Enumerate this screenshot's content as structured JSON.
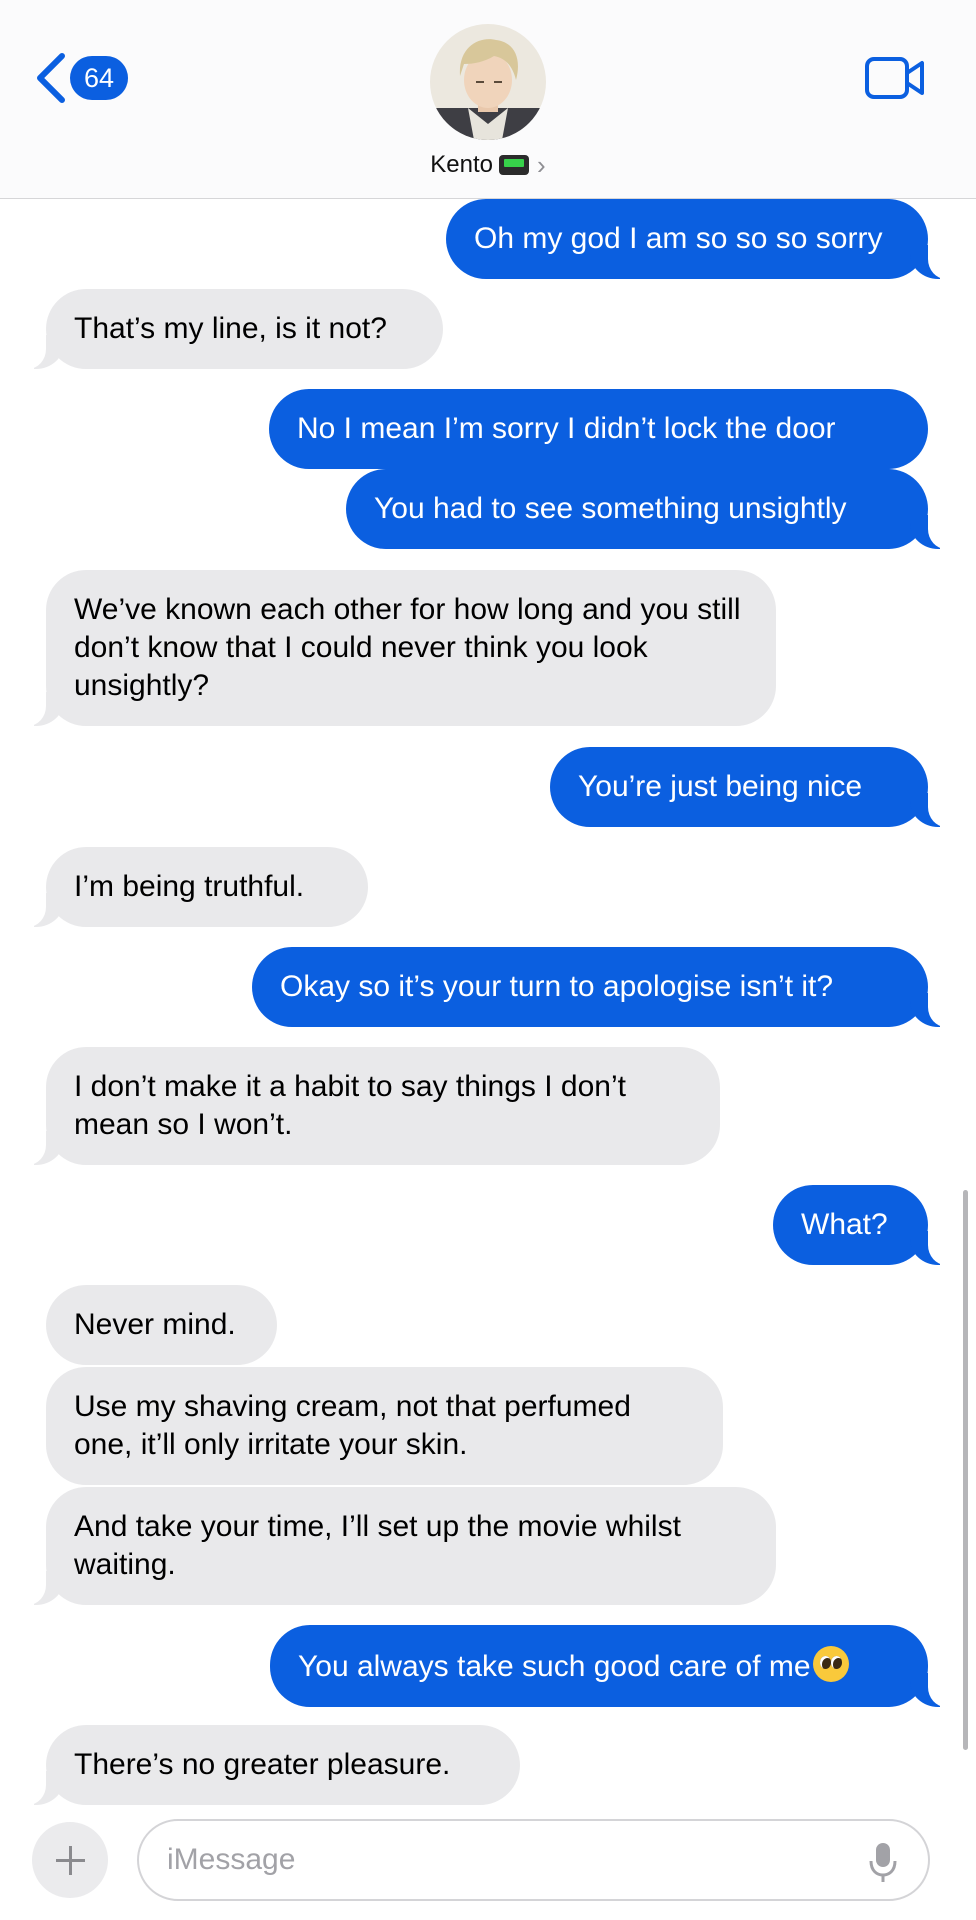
{
  "header": {
    "back_count": "64",
    "contact_name": "Kento"
  },
  "messages": [
    {
      "from": "me",
      "text": "Oh my god I am so so so sorry"
    },
    {
      "from": "them",
      "text": "That’s my line, is it not?"
    },
    {
      "from": "me",
      "text": "No I mean I’m sorry I didn’t lock the door"
    },
    {
      "from": "me",
      "text": "You had to see something unsightly"
    },
    {
      "from": "them",
      "text": "We’ve known each other for how long and you still don’t know that I could never think you look unsightly?"
    },
    {
      "from": "me",
      "text": "You’re just being nice"
    },
    {
      "from": "them",
      "text": "I’m being truthful."
    },
    {
      "from": "me",
      "text": "Okay so it’s your turn to apologise isn’t it?"
    },
    {
      "from": "them",
      "text": "I don’t make it a habit to say things I don’t mean so I won’t."
    },
    {
      "from": "me",
      "text": "What?"
    },
    {
      "from": "them",
      "text": "Never mind."
    },
    {
      "from": "them",
      "text": "Use my shaving cream, not that perfumed one, it’ll only irritate your skin."
    },
    {
      "from": "them",
      "text": "And take your time, I’ll set up the movie whilst waiting."
    },
    {
      "from": "me",
      "text": "You always take such good care of me",
      "emoji": "pleading-face"
    },
    {
      "from": "them",
      "text": "There’s no greater pleasure."
    }
  ],
  "composer": {
    "placeholder": "iMessage"
  },
  "colors": {
    "outgoing_bubble": "#0b5fe0",
    "incoming_bubble": "#e9e9eb",
    "accent": "#0b5fe0"
  },
  "icons": {
    "back": "chevron-left-icon",
    "video": "video-camera-icon",
    "add": "plus-icon",
    "mic": "microphone-icon",
    "contact_emoji": "pager-icon"
  }
}
